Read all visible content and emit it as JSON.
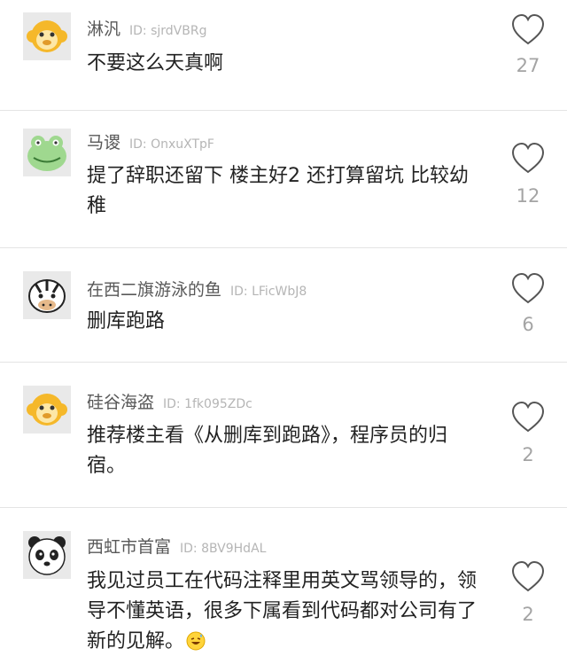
{
  "comments": [
    {
      "name": "淋汎",
      "id": "ID: sjrdVBRg",
      "text": "不要这么天真啊",
      "likes": "27",
      "avatar": "monkey-avatar"
    },
    {
      "name": "马谡",
      "id": "ID: OnxuXTpF",
      "text": "提了辞职还留下 楼主好2 还打算留坑 比较幼稚",
      "likes": "12",
      "avatar": "frog-avatar"
    },
    {
      "name": "在西二旗游泳的鱼",
      "id": "ID: LFicWbJ8",
      "text": "删库跑路",
      "likes": "6",
      "avatar": "zebra-avatar"
    },
    {
      "name": "硅谷海盗",
      "id": "ID: 1fk095ZDc",
      "text": "推荐楼主看《从删库到跑路》，程序员的归宿。",
      "likes": "2",
      "avatar": "monkey-avatar"
    },
    {
      "name": "西虹市首富",
      "id": "ID: 8BV9HdAL",
      "text": "我见过员工在代码注释里用英文骂领导的，领导不懂英语，很多下属看到代码都对公司有了新的见解。",
      "likes": "2",
      "avatar": "panda-avatar",
      "trailing_icon": "grinning-sweat-emoji"
    }
  ],
  "colors": {
    "avatar_bg": "#e9e9e9",
    "monkey": "#f5b82a",
    "frog": "#9fd88f",
    "heart": "#555555"
  }
}
